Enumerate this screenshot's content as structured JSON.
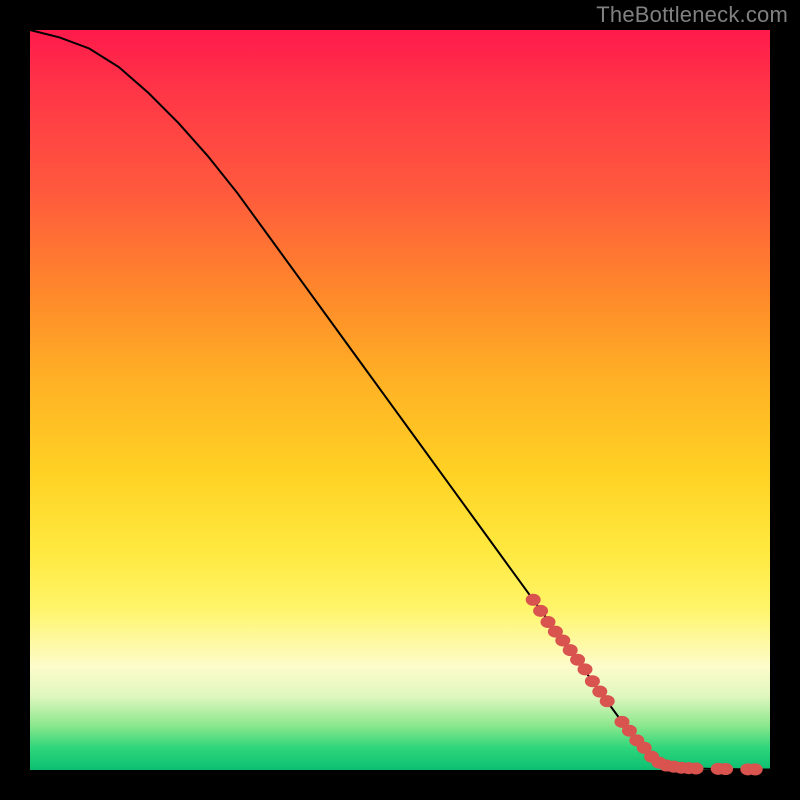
{
  "watermark": "TheBottleneck.com",
  "chart_data": {
    "type": "line",
    "title": "",
    "xlabel": "",
    "ylabel": "",
    "xlim": [
      0,
      100
    ],
    "ylim": [
      0,
      100
    ],
    "grid": false,
    "legend": false,
    "series": [
      {
        "name": "curve",
        "x": [
          0,
          4,
          8,
          12,
          16,
          20,
          24,
          28,
          32,
          36,
          40,
          44,
          48,
          52,
          56,
          60,
          64,
          68,
          72,
          76,
          80,
          82,
          84,
          86,
          88,
          90,
          92,
          94,
          96,
          98,
          100
        ],
        "y": [
          100,
          99,
          97.5,
          95,
          91.5,
          87.5,
          83,
          78,
          72.5,
          67,
          61.5,
          56,
          50.5,
          45,
          39.5,
          34,
          28.5,
          23,
          17.5,
          12,
          6.5,
          4,
          1.8,
          0.6,
          0.3,
          0.2,
          0.15,
          0.12,
          0.1,
          0.08,
          0.07
        ]
      }
    ],
    "markers": {
      "name": "highlighted-points",
      "x": [
        68,
        69,
        70,
        71,
        72,
        73,
        74,
        75,
        76,
        77,
        78,
        80,
        81,
        82,
        83,
        84,
        85,
        86,
        87,
        88,
        89,
        90,
        93,
        94,
        97,
        98
      ],
      "y": [
        23,
        21.5,
        20,
        18.7,
        17.5,
        16.2,
        14.9,
        13.6,
        12,
        10.6,
        9.3,
        6.5,
        5.3,
        4,
        3,
        1.8,
        1.0,
        0.6,
        0.45,
        0.3,
        0.25,
        0.2,
        0.15,
        0.13,
        0.09,
        0.08
      ]
    }
  }
}
